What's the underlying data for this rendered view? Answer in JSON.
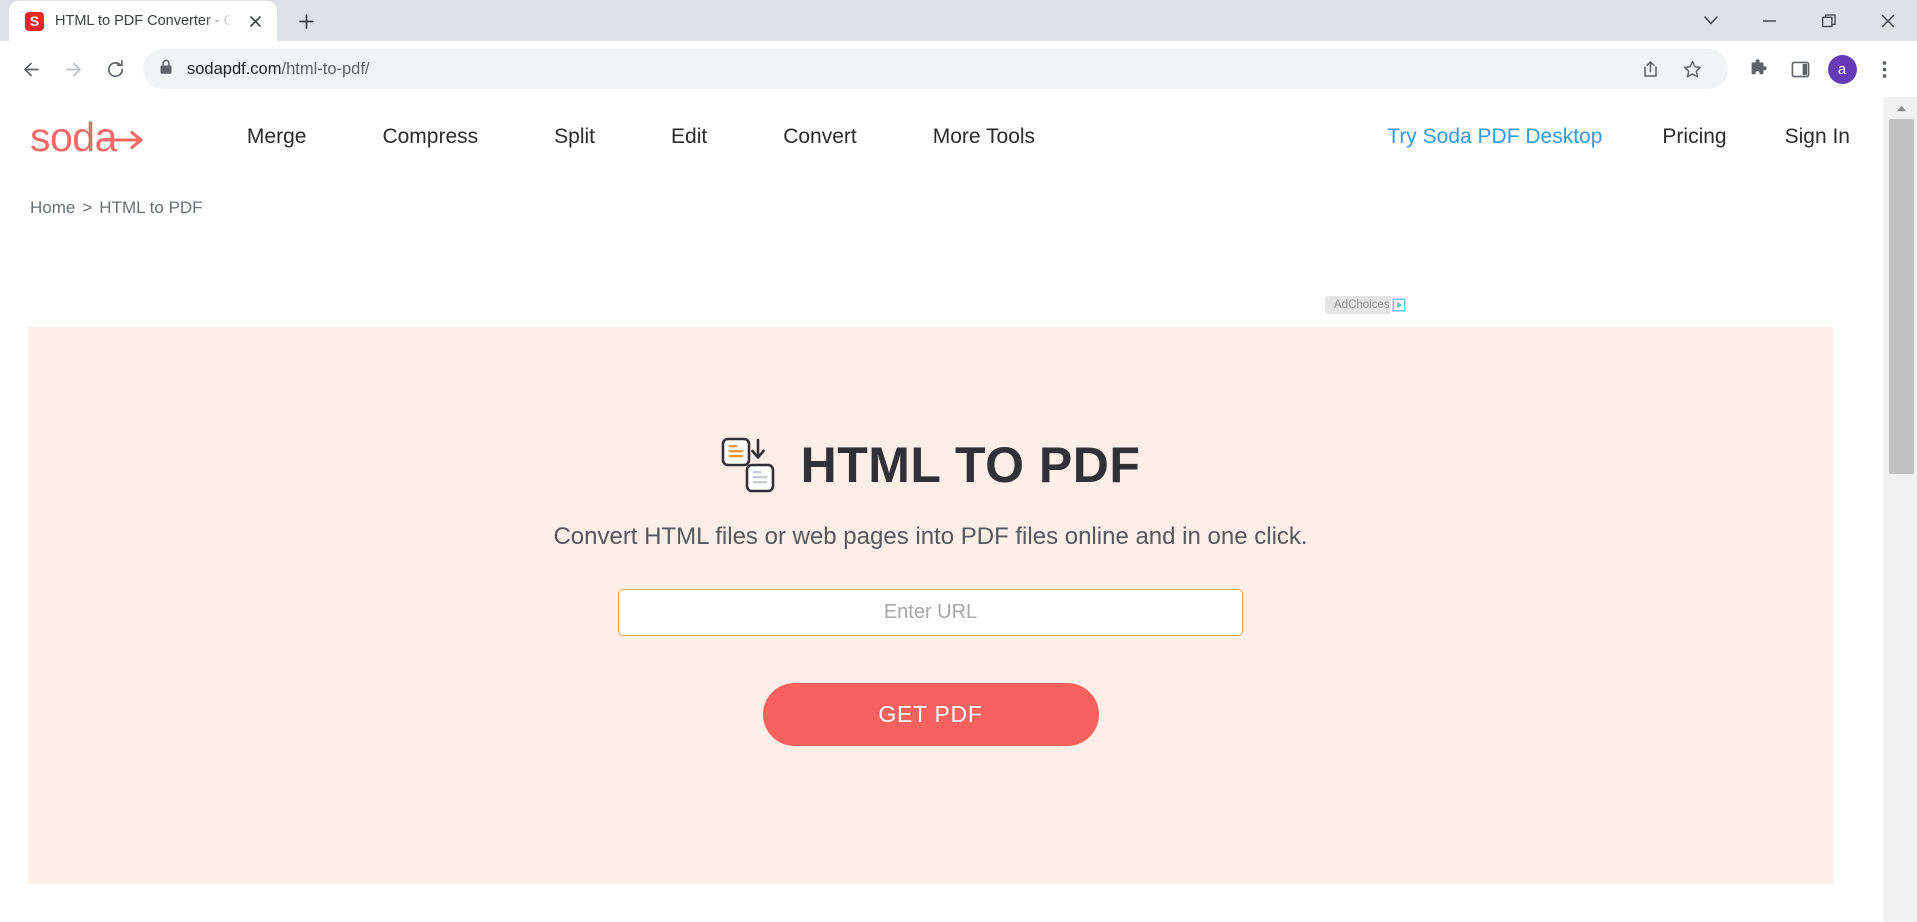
{
  "browser": {
    "tab": {
      "title": "HTML to PDF Converter - Conver",
      "favicon_letter": "S",
      "favicon_color": "#e8252a",
      "close_icon": "close-icon"
    },
    "new_tab_icon": "plus-icon",
    "window_controls": {
      "chevron": "chevron-down-icon",
      "minimize": "minimize-icon",
      "restore": "restore-icon",
      "close": "close-icon"
    },
    "nav": {
      "back_icon": "back-arrow-icon",
      "forward_icon": "forward-arrow-icon",
      "reload_icon": "reload-icon"
    },
    "omnibox": {
      "lock_icon": "lock-icon",
      "url_domain": "sodapdf.com",
      "url_path": "/html-to-pdf/",
      "share_icon": "share-icon",
      "bookmark_icon": "star-icon"
    },
    "toolbar_right": {
      "extensions_icon": "puzzle-icon",
      "sidepanel_icon": "side-panel-icon",
      "profile_letter": "a",
      "profile_color": "#673ab7",
      "menu_icon": "three-dot-menu-icon"
    }
  },
  "site": {
    "logo_text": "soda",
    "logo_color": "#f26b66",
    "nav": [
      {
        "label": "Merge"
      },
      {
        "label": "Compress"
      },
      {
        "label": "Split"
      },
      {
        "label": "Edit"
      },
      {
        "label": "Convert"
      },
      {
        "label": "More Tools"
      }
    ],
    "nav_right": {
      "desktop_label": "Try Soda PDF Desktop",
      "desktop_color": "#2e9bea",
      "pricing_label": "Pricing",
      "signin_label": "Sign In"
    },
    "breadcrumb": {
      "home_label": "Home",
      "separator": ">",
      "current_label": "HTML to PDF"
    },
    "adchoices": {
      "label": "AdChoices",
      "icon": "adchoices-triangle-icon",
      "icon_color": "#4fc3e8"
    },
    "hero": {
      "icon": "html-to-pdf-convert-icon",
      "title": "HTML TO PDF",
      "subtitle": "Convert HTML files or web pages into PDF files online and in one click.",
      "url_input_value": "",
      "url_input_placeholder": "Enter URL",
      "submit_label": "GET PDF",
      "submit_color": "#f9615f",
      "background_color": "#fdefe7",
      "input_border_color": "#eda860"
    }
  }
}
